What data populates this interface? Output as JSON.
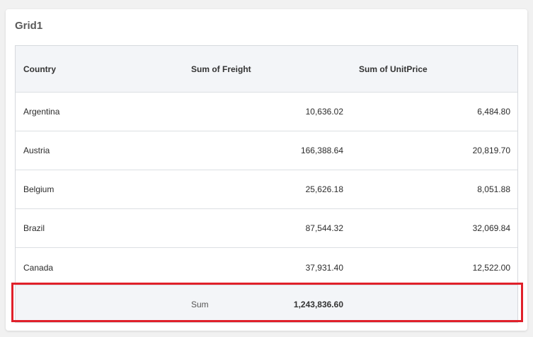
{
  "grid": {
    "title": "Grid1",
    "columns": [
      "Country",
      "Sum of Freight",
      "Sum of UnitPrice"
    ],
    "rows": [
      {
        "country": "Argentina",
        "freight": "10,636.02",
        "unit_price": "6,484.80"
      },
      {
        "country": "Austria",
        "freight": "166,388.64",
        "unit_price": "20,819.70"
      },
      {
        "country": "Belgium",
        "freight": "25,626.18",
        "unit_price": "8,051.88"
      },
      {
        "country": "Brazil",
        "freight": "87,544.32",
        "unit_price": "32,069.84"
      },
      {
        "country": "Canada",
        "freight": "37,931.40",
        "unit_price": "12,522.00"
      }
    ],
    "footer": {
      "label": "Sum",
      "freight_total": "1,243,836.60"
    }
  },
  "colors": {
    "highlight": "#e0202a",
    "header_bg": "#f3f5f8"
  }
}
